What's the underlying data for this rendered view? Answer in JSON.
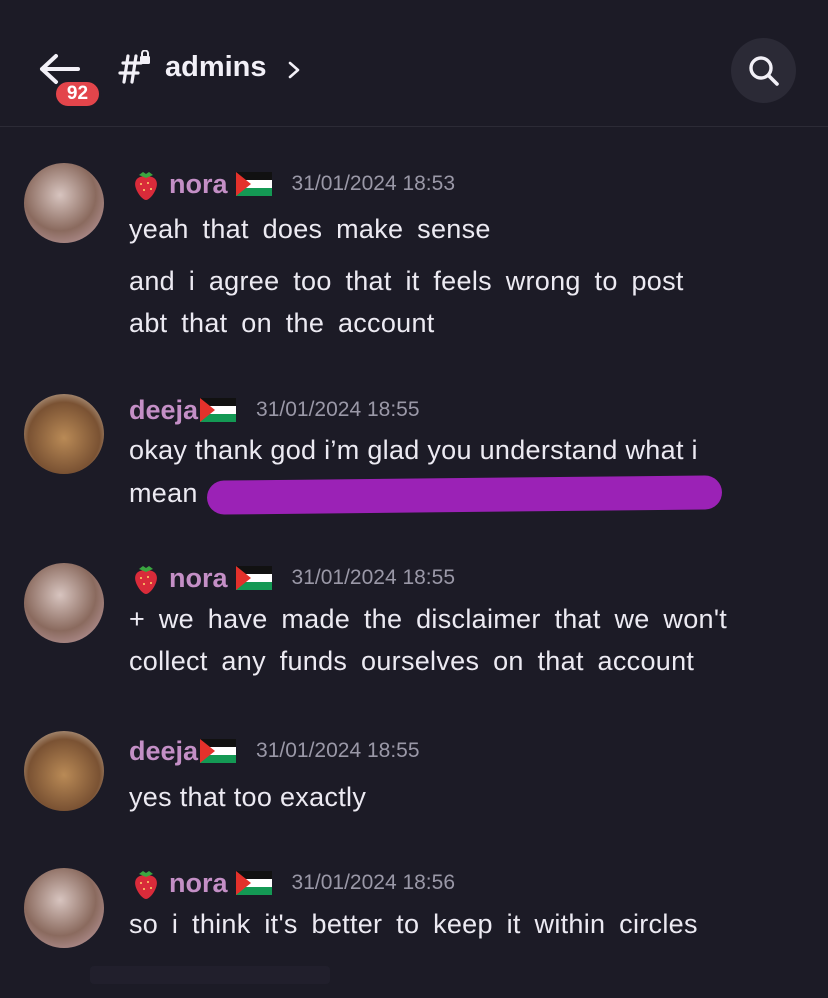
{
  "header": {
    "unread_count": "92",
    "channel_name": "admins",
    "icons": {
      "back": "arrow-left-icon",
      "channel": "locked-hash-icon",
      "chevron": "chevron-right-icon",
      "search": "search-icon"
    }
  },
  "colors": {
    "background": "#1c1b26",
    "username": "#c48fc6",
    "timestamp": "#9a98a7",
    "badge": "#e3454b",
    "redaction": "#9b22b6"
  },
  "messages": [
    {
      "author": "nora",
      "timestamp": "31/01/2024 18:53",
      "lines": [
        "yeah that does make sense",
        "and i agree too that it feels wrong to post",
        "abt that on the account"
      ]
    },
    {
      "author": "deeja",
      "timestamp": "31/01/2024 18:55",
      "lines": [
        "okay thank god i’m glad you understand what i",
        "mean"
      ]
    },
    {
      "author": "nora",
      "timestamp": "31/01/2024 18:55",
      "lines": [
        "+ we have made the disclaimer that we won't",
        "collect any funds ourselves on that account"
      ]
    },
    {
      "author": "deeja",
      "timestamp": "31/01/2024 18:55",
      "lines": [
        "yes that too exactly"
      ]
    },
    {
      "author": "nora",
      "timestamp": "31/01/2024 18:56",
      "lines": [
        "so i think it's better to keep it within circles"
      ]
    }
  ]
}
